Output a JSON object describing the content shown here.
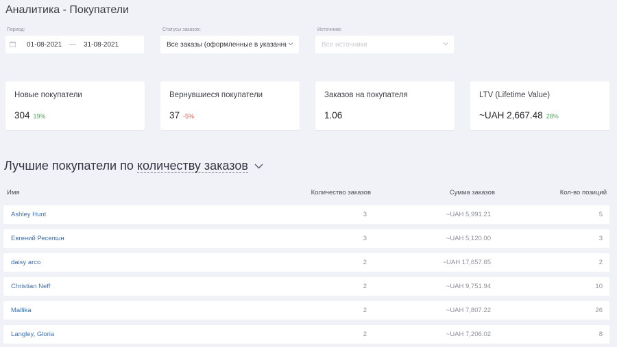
{
  "page": {
    "title": "Аналитика - Покупатели"
  },
  "filters": {
    "period_label": "Период:",
    "date_from": "01-08-2021",
    "date_sep": "—",
    "date_to": "31-08-2021",
    "status_label": "Статусы заказов:",
    "status_value": "Все заказы (оформленные в указанный период)",
    "source_label": "Источники:",
    "source_placeholder": "Все источники"
  },
  "cards": [
    {
      "label": "Новые покупатели",
      "value": "304",
      "delta": "19%",
      "delta_color": "#46a754"
    },
    {
      "label": "Вернувшиеся покупатели",
      "value": "37",
      "delta": "-5%",
      "delta_color": "#e0533f"
    },
    {
      "label": "Заказов на покупателя",
      "value": "1.06",
      "delta": ""
    },
    {
      "label": "LTV (Lifetime Value)",
      "value": "~UAH 2,667.48",
      "delta": "28%",
      "delta_color": "#46a754"
    }
  ],
  "section": {
    "prefix": "Лучшие покупатели по",
    "sort_link": "количеству заказов"
  },
  "table": {
    "headers": {
      "name": "Имя",
      "count": "Количество заказов",
      "sum": "Сумма заказов",
      "items": "Кол-во позиций"
    },
    "rows": [
      {
        "name": "Ashley Hunt",
        "count": "3",
        "sum": "~UAH 5,991.21",
        "items": "5"
      },
      {
        "name": "Евгений Ресепшн",
        "count": "3",
        "sum": "~UAH 5,120.00",
        "items": "3"
      },
      {
        "name": "daisy arco",
        "count": "2",
        "sum": "~UAH 17,657.65",
        "items": "2"
      },
      {
        "name": "Christian Neff",
        "count": "2",
        "sum": "~UAH 9,751.94",
        "items": "10"
      },
      {
        "name": "Mallika",
        "count": "2",
        "sum": "~UAH 7,807.22",
        "items": "26"
      },
      {
        "name": "Langley, Gloria",
        "count": "2",
        "sum": "~UAH 7,206.02",
        "items": "8"
      }
    ]
  }
}
